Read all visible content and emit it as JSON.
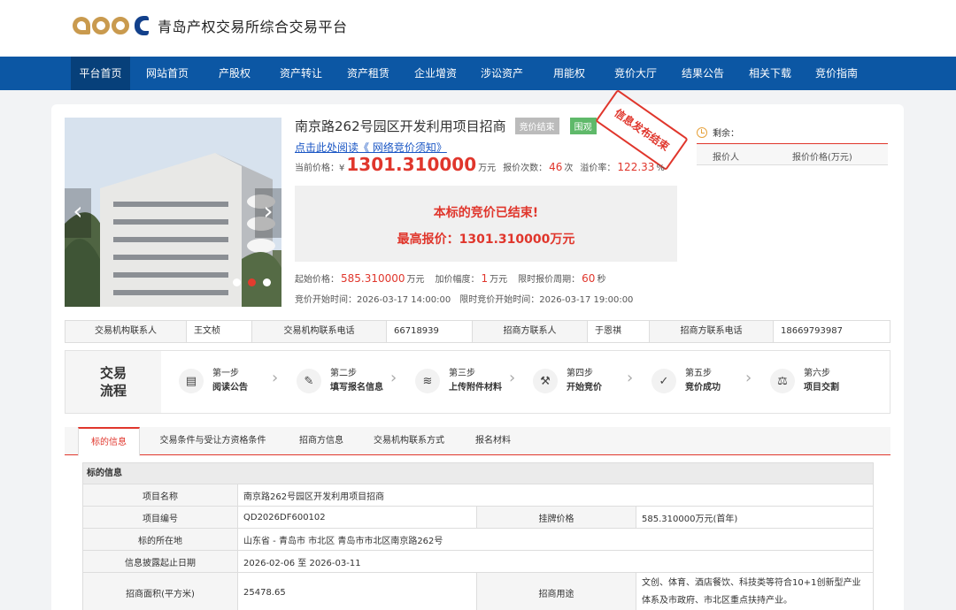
{
  "header": {
    "logo_text": "青岛产权交易所综合交易平台"
  },
  "nav": [
    "平台首页",
    "网站首页",
    "产股权",
    "资产转让",
    "资产租赁",
    "企业增资",
    "涉讼资产",
    "用能权",
    "竞价大厅",
    "结果公告",
    "相关下载",
    "竞价指南"
  ],
  "project": {
    "title": "南京路262号园区开发利用项目招商",
    "status_badge": "竞价结束",
    "tag_badge": "围观",
    "stamp": "信息发布结束",
    "notice_link": "点击此处阅读《 网络竞价须知》",
    "current_price_label": "当前价格：¥",
    "current_price": "1301.310000",
    "price_unit": "万元",
    "bid_count_label": "报价次数：",
    "bid_count": "46",
    "bid_count_unit": "次",
    "premium_label": "溢价率：",
    "premium": "122.33",
    "premium_unit": "%",
    "result_line1": "本标的竞价已结束!",
    "result_line2": "最高报价：1301.310000万元",
    "start_price_label": "起始价格：",
    "start_price": "585.310000",
    "start_price_unit": "万元",
    "increment_label": "加价幅度：",
    "increment": "1",
    "increment_unit": "万元",
    "cycle_label": "限时报价周期：",
    "cycle": "60",
    "cycle_unit": "秒",
    "start_time": "竞价开始时间：2026-03-17 14:00:00",
    "timed_start_time": "限时竞价开始时间：2026-03-17 19:00:00"
  },
  "side": {
    "remain_label": "剩余：",
    "col1": "报价人",
    "col2": "报价价格(万元)"
  },
  "contacts": [
    {
      "label": "交易机构联系人",
      "value": "王文桢"
    },
    {
      "label": "交易机构联系电话",
      "value": "66718939"
    },
    {
      "label": "招商方联系人",
      "value": "于恩祺"
    },
    {
      "label": "招商方联系电话",
      "value": "18669793987"
    }
  ],
  "process": {
    "title1": "交易",
    "title2": "流程",
    "steps": [
      {
        "num": "第一步",
        "name": "阅读公告"
      },
      {
        "num": "第二步",
        "name": "填写报名信息"
      },
      {
        "num": "第三步",
        "name": "上传附件材料"
      },
      {
        "num": "第四步",
        "name": "开始竞价"
      },
      {
        "num": "第五步",
        "name": "竞价成功"
      },
      {
        "num": "第六步",
        "name": "项目交割"
      }
    ]
  },
  "tabs": [
    "标的信息",
    "交易条件与受让方资格条件",
    "招商方信息",
    "交易机构联系方式",
    "报名材料"
  ],
  "detail": {
    "section": "标的信息",
    "name_label": "项目名称",
    "name_value": "南京路262号园区开发利用项目招商",
    "code_label": "项目编号",
    "code_value": "QD2026DF600102",
    "list_price_label": "挂牌价格",
    "list_price_value": "585.310000万元(首年)",
    "location_label": "标的所在地",
    "location_value": "山东省 - 青岛市 市北区 青岛市市北区南京路262号",
    "period_label": "信息披露起止日期",
    "period_value": "2026-02-06 至 2026-03-11",
    "area_label": "招商面积(平方米)",
    "area_value": "25478.65",
    "usage_label": "招商用途",
    "usage_value": "文创、体育、酒店餐饮、科技类等符合10+1创新型产业体系及市政府、市北区重点扶持产业。"
  }
}
